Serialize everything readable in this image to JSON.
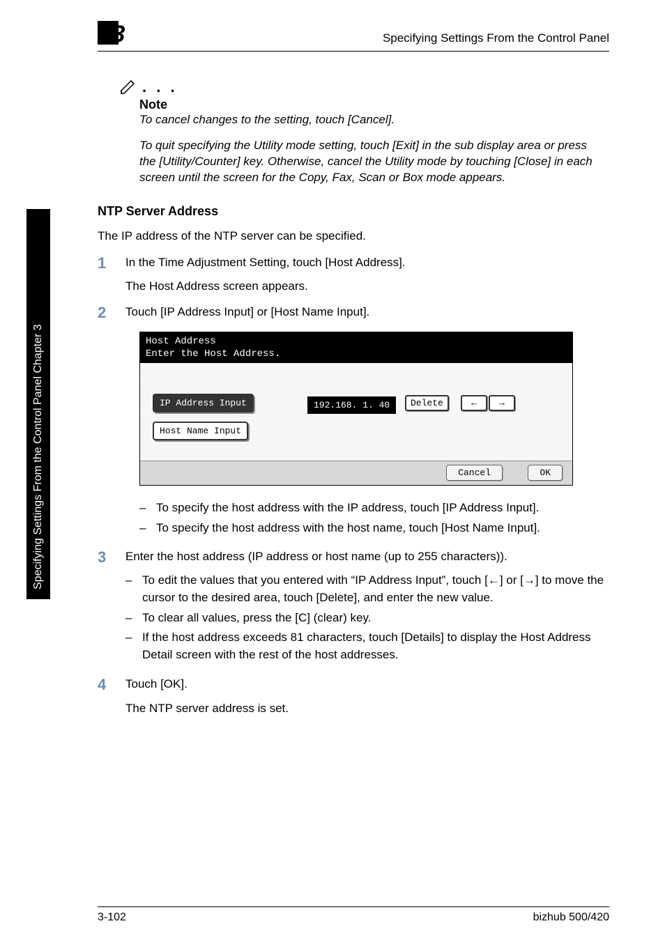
{
  "header": {
    "chapter_number": "3",
    "running_title": "Specifying Settings From the Control Panel"
  },
  "side_tab": "Specifying Settings From the Control Panel    Chapter 3",
  "note": {
    "icon_dots": ". . .",
    "heading": "Note",
    "p1": "To cancel changes to the setting, touch [Cancel].",
    "p2": "To quit specifying the Utility mode setting, touch [Exit] in the sub display area or press the [Utility/Counter] key. Otherwise, cancel the Utility mode by touching [Close] in each screen until the screen for the Copy, Fax, Scan or Box mode appears."
  },
  "section": {
    "heading": "NTP Server Address",
    "intro": "The IP address of the NTP server can be specified."
  },
  "steps": {
    "s1": {
      "num": "1",
      "text": "In the Time Adjustment Setting, touch [Host Address].",
      "sub": "The Host Address screen appears."
    },
    "s2": {
      "num": "2",
      "text": "Touch [IP Address Input] or [Host Name Input]."
    },
    "s2_bullets": {
      "b1": "To specify the host address with the IP address, touch [IP Address Input].",
      "b2": "To specify the host address with the host name, touch [Host Name Input]."
    },
    "s3": {
      "num": "3",
      "text": "Enter the host address (IP address or host name (up to 255 characters)).",
      "b1": "To edit the values that you entered with “IP Address Input”, touch [←] or [→] to move the cursor to the desired area, touch [Delete], and enter the new value.",
      "b2": "To clear all values, press the [C] (clear) key.",
      "b3": "If the host address exceeds 81 characters, touch [Details] to display the Host Address Detail screen with the rest of the host addresses."
    },
    "s4": {
      "num": "4",
      "text": "Touch [OK].",
      "sub": "The NTP server address is set."
    }
  },
  "screenshot": {
    "title_line1": "Host Address",
    "title_line2": "Enter the Host Address.",
    "btn_ip": "IP Address Input",
    "btn_host": "Host Name Input",
    "ip_value": "192.168.  1. 40",
    "btn_delete": "Delete",
    "btn_left": "←",
    "btn_right": "→",
    "btn_cancel": "Cancel",
    "btn_ok": "OK"
  },
  "footer": {
    "page": "3-102",
    "product": "bizhub 500/420"
  },
  "dash": "–"
}
